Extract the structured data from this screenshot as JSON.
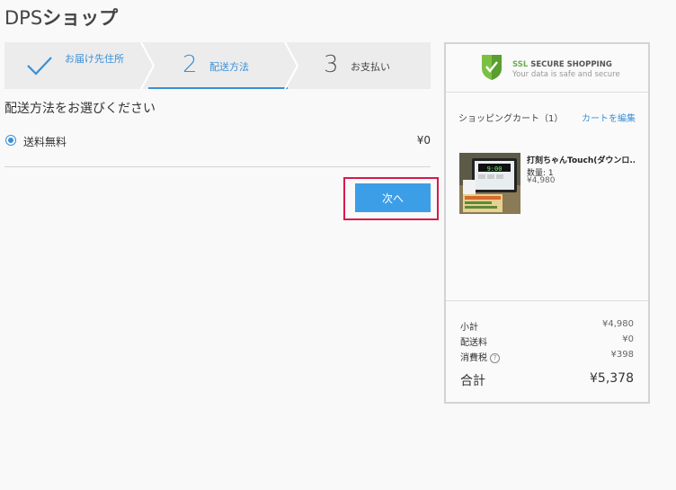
{
  "header": {
    "title_latin": "DPS",
    "title_jp": "ショップ"
  },
  "steps": [
    {
      "label": "お届け先住所",
      "state": "done"
    },
    {
      "number": "2",
      "label": "配送方法",
      "state": "active"
    },
    {
      "number": "3",
      "label": "お支払い",
      "state": "pending"
    }
  ],
  "shipping": {
    "title": "配送方法をお選びください",
    "options": [
      {
        "label": "送料無料",
        "price": "¥0",
        "selected": true
      }
    ]
  },
  "next_button": {
    "label": "次へ"
  },
  "cart": {
    "ssl_prefix": "SSL",
    "ssl_title": "SECURE SHOPPING",
    "ssl_subtitle": "Your data is safe and secure",
    "heading": "ショッピングカート（1）",
    "edit_link": "カートを編集",
    "product": {
      "name": "打刻ちゃんTouch(ダウンロ...",
      "qty": "数量: 1",
      "price": "¥4,980",
      "screen_text": "9:00"
    },
    "totals": [
      {
        "label": "小計",
        "value": "¥4,980"
      },
      {
        "label": "配送料",
        "value": "¥0"
      },
      {
        "label": "消費税",
        "value": "¥398",
        "help": "?"
      }
    ],
    "grand_total": {
      "label": "合計",
      "value": "¥5,378"
    }
  },
  "colors": {
    "accent": "#3a8fd6",
    "button": "#3d9ee8",
    "highlight": "#d9194b",
    "ssl_green": "#6ab04c"
  }
}
